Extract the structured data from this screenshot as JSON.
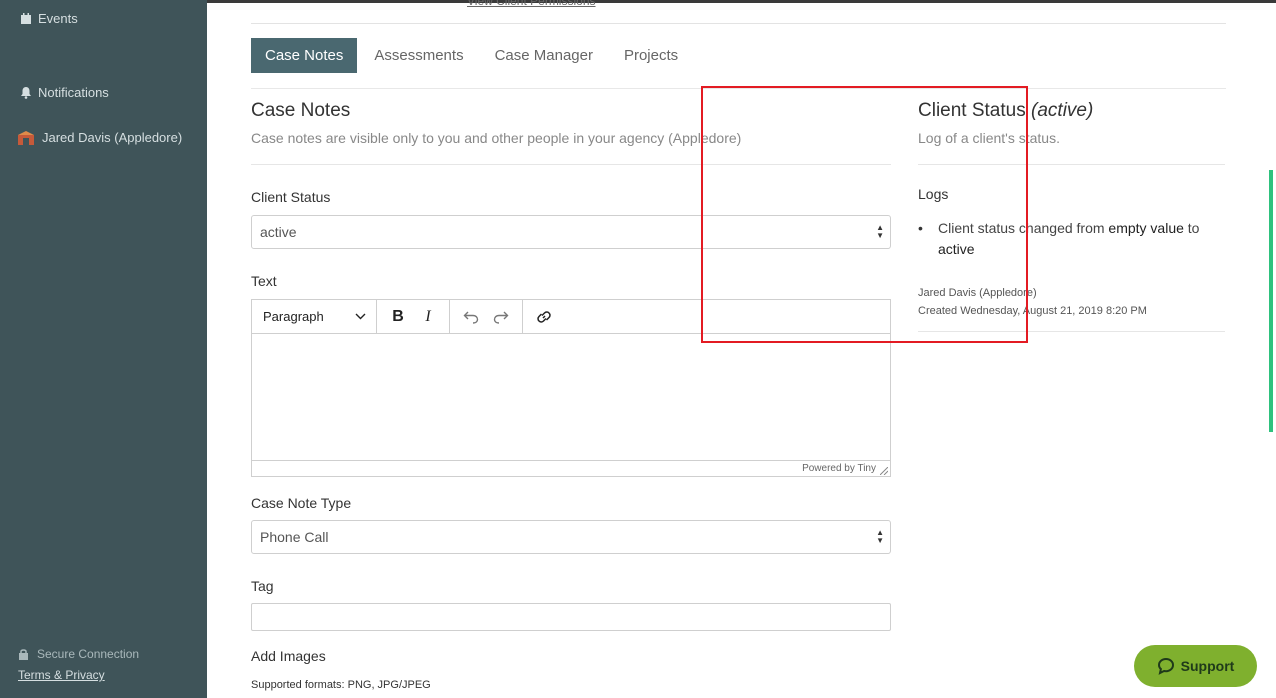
{
  "sidebar": {
    "events": "Events",
    "notifications": "Notifications",
    "user": "Jared Davis (Appledore)",
    "secure": "Secure Connection",
    "terms": "Terms & Privacy"
  },
  "header": {
    "top_link": "View Client Permissions"
  },
  "tabs": [
    {
      "label": "Case Notes",
      "active": true
    },
    {
      "label": "Assessments",
      "active": false
    },
    {
      "label": "Case Manager",
      "active": false
    },
    {
      "label": "Projects",
      "active": false
    }
  ],
  "case_notes": {
    "title": "Case Notes",
    "subtitle": "Case notes are visible only to you and other people in your agency (Appledore)",
    "client_status_label": "Client Status",
    "client_status_value": "active",
    "text_label": "Text",
    "editor": {
      "format": "Paragraph",
      "bold": "B",
      "italic": "I",
      "powered_by": "Powered by Tiny"
    },
    "case_note_type_label": "Case Note Type",
    "case_note_type_value": "Phone Call",
    "tag_label": "Tag",
    "add_images_label": "Add Images",
    "supported_formats": "Supported formats: PNG, JPG/JPEG"
  },
  "client_status_panel": {
    "title": "Client Status",
    "status": "(active)",
    "subtitle": "Log of a client's status.",
    "logs_label": "Logs",
    "log_text_prefix": "Client status changed from",
    "log_from": "empty value",
    "log_text_mid": "to",
    "log_to": "active",
    "author": "Jared Davis (Appledore)",
    "created": "Created Wednesday, August 21, 2019 8:20 PM"
  },
  "support": {
    "label": "Support"
  },
  "colors": {
    "sidebar": "#3f5459",
    "active_tab": "#4a6870",
    "highlight": "#e31b23",
    "support": "#7fb02e",
    "scroll_accent": "#2ec27e"
  }
}
